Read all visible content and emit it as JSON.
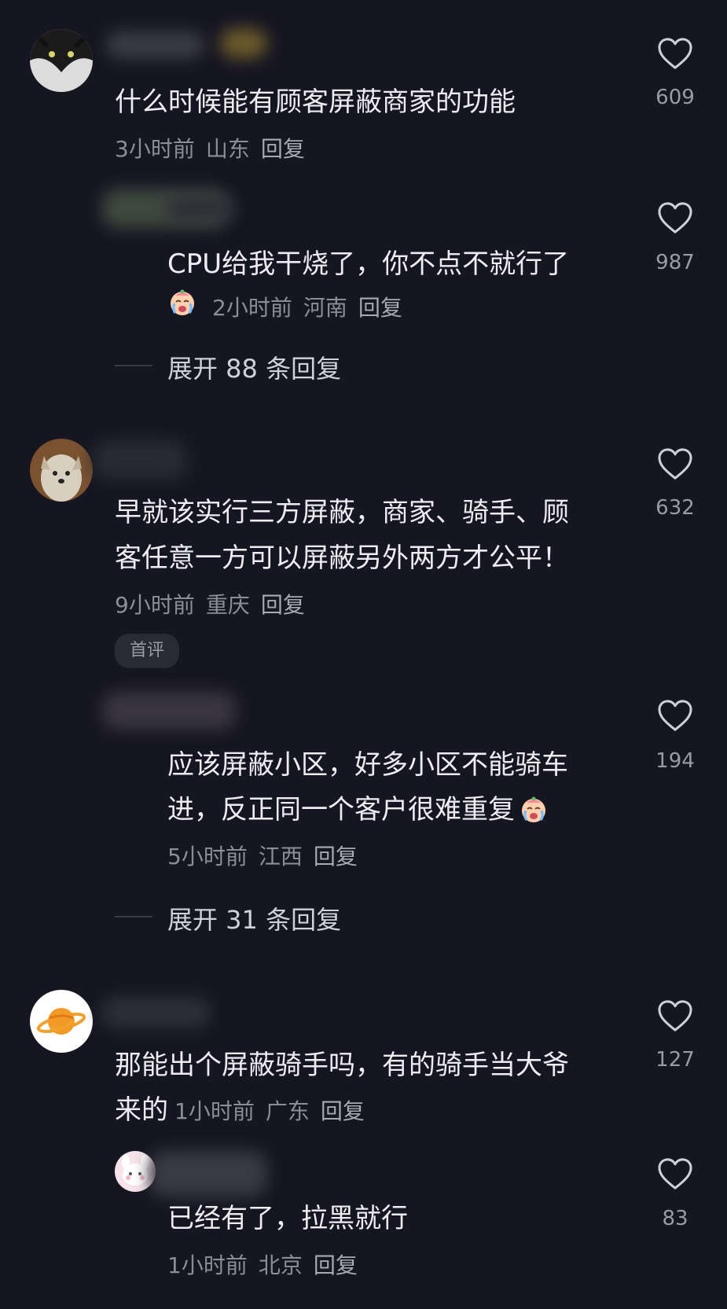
{
  "comments": [
    {
      "text": "什么时候能有顾客屏蔽商家的功能",
      "time": "3小时前",
      "location": "山东",
      "reply": "回复",
      "likes": "609",
      "reply_item": {
        "text": "CPU给我干烧了，你不点不就行了",
        "time": "2小时前",
        "location": "河南",
        "reply": "回复",
        "likes": "987"
      },
      "expand": "展开 88 条回复"
    },
    {
      "text_lines": [
        "早就该实行三方屏蔽，商家、骑手、顾",
        "客任意一方可以屏蔽另外两方才公平！"
      ],
      "time": "9小时前",
      "location": "重庆",
      "reply": "回复",
      "likes": "632",
      "tag": "首评",
      "reply_item": {
        "text_lines": [
          "应该屏蔽小区，好多小区不能骑车",
          "进，反正同一个客户很难重复"
        ],
        "time": "5小时前",
        "location": "江西",
        "reply": "回复",
        "likes": "194"
      },
      "expand": "展开 31 条回复"
    },
    {
      "text_lines": [
        "那能出个屏蔽骑手吗，有的骑手当大爷",
        "来的"
      ],
      "time": "1小时前",
      "location": "广东",
      "reply": "回复",
      "likes": "127",
      "reply_item": {
        "text": "已经有了，拉黑就行",
        "time": "1小时前",
        "location": "北京",
        "reply": "回复",
        "likes": "83"
      }
    }
  ],
  "colors": {
    "background": "#161622",
    "text": "#ececf1",
    "meta": "#8d8d99"
  },
  "icons": [
    "heart-outline-icon",
    "crying-emoji-icon",
    "planet-avatar-icon"
  ]
}
